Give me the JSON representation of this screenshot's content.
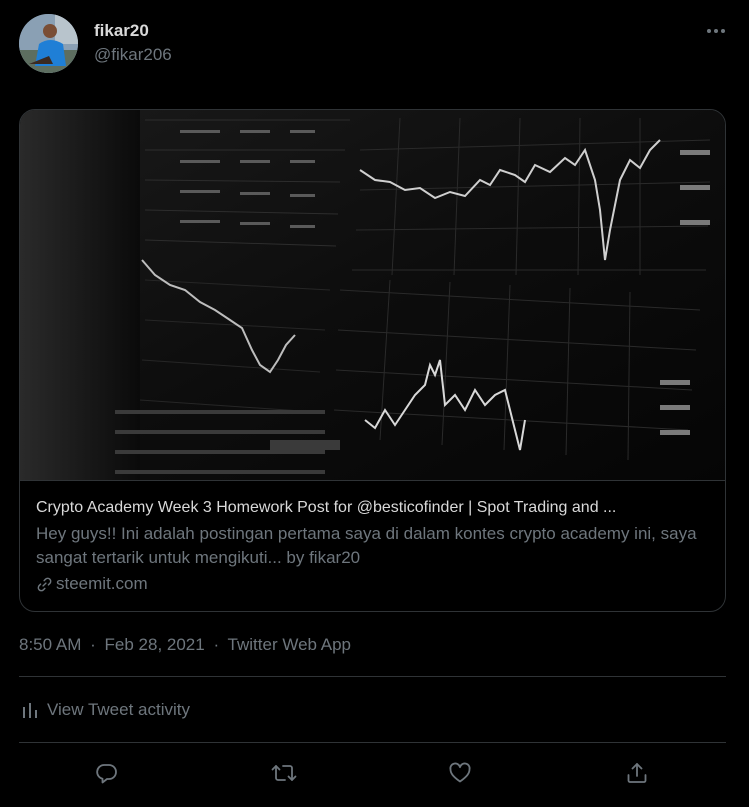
{
  "user": {
    "display_name": "fikar20",
    "handle": "@fikar206"
  },
  "card": {
    "title": "Crypto Academy Week 3 Homework Post for @besticofinder | Spot Trading and ...",
    "description": "Hey guys!! Ini adalah postingan pertama saya di dalam kontes crypto academy ini, saya sangat tertarik untuk mengikuti... by fikar20",
    "domain": "steemit.com"
  },
  "meta": {
    "time": "8:50 AM",
    "date": "Feb 28, 2021",
    "source": "Twitter Web App",
    "separator": "·"
  },
  "activity": {
    "label": "View Tweet activity"
  },
  "icons": {
    "more": "more-horizontal-icon",
    "link": "link-icon",
    "activity": "bar-chart-icon",
    "reply": "reply-icon",
    "retweet": "retweet-icon",
    "like": "heart-icon",
    "share": "share-icon"
  },
  "colors": {
    "background": "#000000",
    "primary_text": "#d9d9d9",
    "secondary_text": "#6e767d",
    "border": "#2f3336"
  }
}
